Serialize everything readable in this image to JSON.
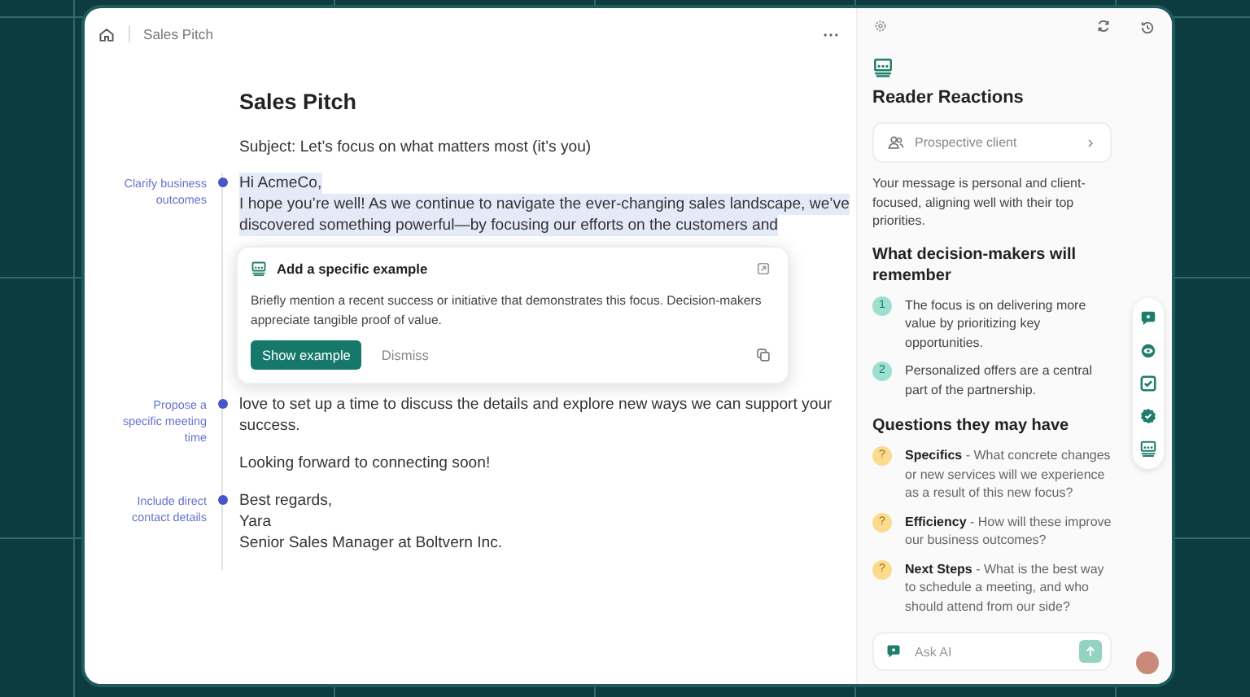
{
  "breadcrumb": {
    "title": "Sales Pitch"
  },
  "document": {
    "title": "Sales Pitch",
    "subject": "Subject: Let’s focus on what matters most (it’s you)",
    "blocks": [
      {
        "annotation": "Clarify business outcomes",
        "highlighted": true,
        "lines": [
          "Hi AcmeCo,",
          "I hope you’re well! As we continue to navigate the ever-changing sales landscape, we’ve",
          "discovered something powerful—by focusing our efforts on the customers and"
        ]
      },
      {
        "annotation": "Propose a specific meeting time",
        "highlighted": false,
        "lines": [
          "love to set up a time to discuss the details and explore new ways we can support your",
          "success."
        ]
      },
      {
        "highlighted": false,
        "lines": [
          "Looking forward to connecting soon!"
        ]
      },
      {
        "annotation": "Include direct contact details",
        "highlighted": false,
        "lines": [
          "Best regards,",
          "Yara",
          "Senior Sales Manager at Boltvern Inc."
        ]
      }
    ]
  },
  "suggestion": {
    "title": "Add a specific example",
    "body": "Briefly mention a recent success or initiative that demonstrates this focus. Decision-makers appreciate tangible proof of value.",
    "primary": "Show example",
    "secondary": "Dismiss"
  },
  "panel": {
    "title": "Reader Reactions",
    "persona": "Prospective client",
    "summary": "Your message is personal and client-focused, aligning well with their top priorities.",
    "remember": {
      "heading": "What decision-makers will remember",
      "items": [
        {
          "badge": "1",
          "text": "The focus is on delivering more value by prioritizing key opportunities."
        },
        {
          "badge": "2",
          "text": "Personalized offers are a central part of the partnership."
        }
      ]
    },
    "questions": {
      "heading": "Questions they may have",
      "items": [
        {
          "badge": "?",
          "text": "**Specifics** - What concrete changes or new services will we experience as a result of this new focus?"
        },
        {
          "badge": "?",
          "text": "**Efficiency** - How will these improve our business outcomes?"
        },
        {
          "badge": "?",
          "text": "**Next Steps** - What is the best way to schedule a meeting, and who should attend from our side?"
        }
      ]
    }
  },
  "ask": {
    "placeholder": "Ask AI"
  }
}
